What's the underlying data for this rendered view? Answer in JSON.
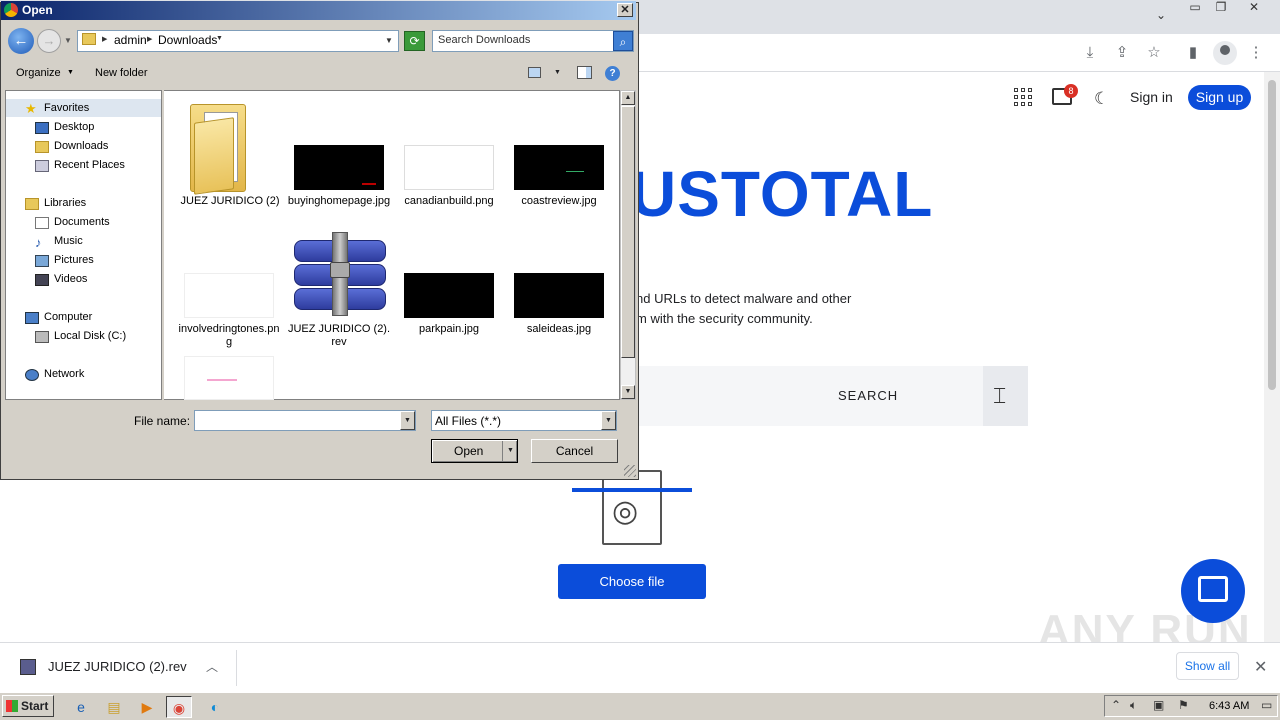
{
  "dialog": {
    "title": "Open",
    "breadcrumb": [
      "admin",
      "Downloads"
    ],
    "search_placeholder": "Search Downloads",
    "commands": {
      "organize": "Organize",
      "new_folder": "New folder"
    },
    "nav": {
      "favorites": "Favorites",
      "desktop": "Desktop",
      "downloads": "Downloads",
      "recent": "Recent Places",
      "libraries": "Libraries",
      "documents": "Documents",
      "music": "Music",
      "pictures": "Pictures",
      "videos": "Videos",
      "computer": "Computer",
      "local_disk": "Local Disk (C:)",
      "network": "Network"
    },
    "files": [
      {
        "name": "JUEZ JURIDICO (2)"
      },
      {
        "name": "buyinghomepage.jpg"
      },
      {
        "name": "canadianbuild.png"
      },
      {
        "name": "coastreview.jpg"
      },
      {
        "name": "involvedringtones.png"
      },
      {
        "name": "JUEZ JURIDICO (2).rev"
      },
      {
        "name": "parkpain.jpg"
      },
      {
        "name": "saleideas.jpg"
      }
    ],
    "file_name_label": "File name:",
    "file_name_value": "",
    "file_type": "All Files (*.*)",
    "open_label": "Open",
    "cancel_label": "Cancel"
  },
  "page": {
    "notifications_count": "8",
    "sign_in": "Sign in",
    "sign_up": "Sign up",
    "brand_partial": "USTOTAL",
    "desc_line1": "nd URLs to detect malware and other",
    "desc_line2": "m with the security community.",
    "search_label": "SEARCH",
    "choose_file": "Choose file",
    "accent_color": "#0b4dda"
  },
  "downloads_bar": {
    "file_name": "JUEZ JURIDICO (2).rev",
    "show_all": "Show all"
  },
  "watermark": "ANY RUN",
  "taskbar": {
    "start": "Start",
    "clock": "6:43 AM"
  }
}
